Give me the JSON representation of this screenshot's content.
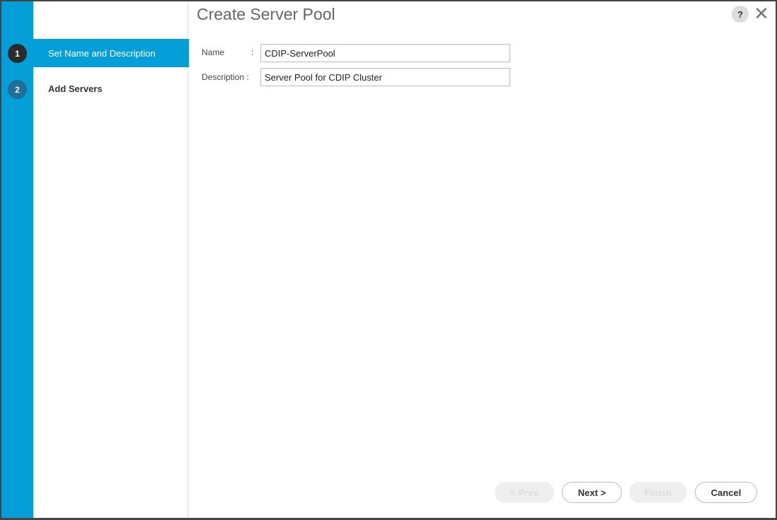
{
  "dialog": {
    "title": "Create Server Pool",
    "help_label": "?",
    "close_label": "✕"
  },
  "steps": [
    {
      "number": "1",
      "label": "Set Name and Description"
    },
    {
      "number": "2",
      "label": "Add Servers"
    }
  ],
  "form": {
    "name_label": "Name",
    "description_label": "Description :",
    "colon": ":",
    "name_value": "CDIP-ServerPool",
    "description_value": "Server Pool for CDIP Cluster"
  },
  "buttons": {
    "prev": "< Prev",
    "next": "Next >",
    "finish": "Finish",
    "cancel": "Cancel"
  }
}
